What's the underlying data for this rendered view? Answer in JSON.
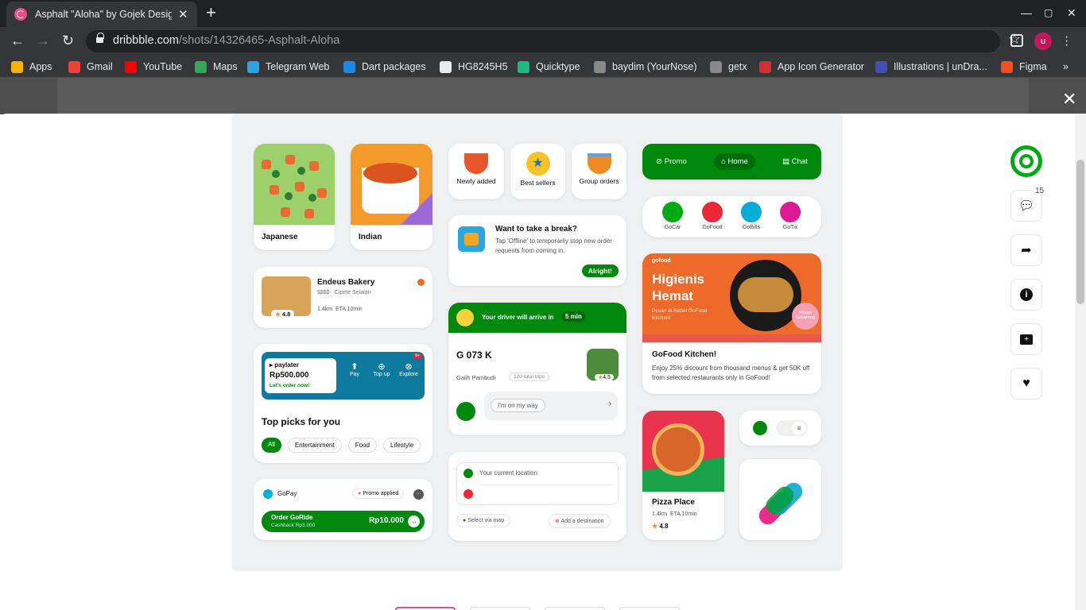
{
  "browser": {
    "tab_title": "Asphalt \"Aloha\" by Gojek Design",
    "url_domain": "dribbble.com",
    "url_path": "/shots/14326465-Asphalt-Aloha",
    "bookmarks": [
      "Apps",
      "Gmail",
      "YouTube",
      "Maps",
      "Telegram Web",
      "Dart packages",
      "HG8245H5",
      "Quicktype",
      "baydim (YourNose)",
      "getx",
      "App Icon Generator",
      "Illustrations | unDra...",
      "Figma"
    ],
    "bookmark_colors": [
      "#f4b400",
      "#ea4335",
      "#ff0000",
      "#34a853",
      "#2aa3e0",
      "#1e88e5",
      "#e8eaed",
      "#1eb980",
      "#888888",
      "#888888",
      "#d32f2f",
      "#3f51b5",
      "#f24e1e"
    ],
    "avatar_letter": "u"
  },
  "shot": {
    "japanese": "Japanese",
    "indian": "Indian",
    "newly_added": "Newly added",
    "best_sellers": "Best sellers",
    "group_orders": "Group orders",
    "break_title": "Want to take a break?",
    "break_body": "Tap 'Offline' to temporarily stop new order requests from coming in.",
    "alright": "Alright!",
    "nav_promo": "Promo",
    "nav_home": "Home",
    "nav_chat": "Chat",
    "svc_gocar": "GoCar",
    "svc_gofood": "GoFood",
    "svc_gobills": "GoBills",
    "svc_gotix": "GoTix",
    "bakery_name": "Endeus Bakery",
    "bakery_meta": "$$$$ · Cipete Selatan",
    "bakery_rating": "4.8",
    "bakery_dist": "1.4km",
    "bakery_eta": "ETA 10min",
    "driver_banner": "Your driver will arrive in",
    "driver_eta": "5 min",
    "plate": "G 073 K",
    "driver_name": "Galih Pambudi",
    "driver_trips": "120 total trips",
    "driver_rating": "4.5",
    "on_my_way": "I'm on my way",
    "gofood_brand": "gofood",
    "hero_line1": "Higienis",
    "hero_line2": "Hemat",
    "hero_sub": "Pesan di Rebel GoFood Kitchen!",
    "hero_badge": "Pesan Sekarang",
    "kitchen_title": "GoFood Kitchen!",
    "kitchen_body": "Enjoy 25% discount from thousand menus & get 50K off from selected restaurants only in GoFood!",
    "paylater": "paylater",
    "paylater_amount": "Rp500.000",
    "paylater_cta": "Let's order now!",
    "pay": "Pay",
    "topup": "Top up",
    "explore": "Explore",
    "explore_badge": "9+",
    "top_picks": "Top picks for you",
    "chips": [
      "All",
      "Entertainment",
      "Food",
      "Lifestyle"
    ],
    "current_location": "Your current location",
    "select_map": "Select via map",
    "add_destination": "Add a destination",
    "pizza_name": "Pizza Place",
    "pizza_dist": "1.4km",
    "pizza_eta": "ETA 10min",
    "pizza_rating": "4.8",
    "gopay": "GoPay",
    "promo_applied": "Promo applied",
    "order_goride": "Order GoRide",
    "cashback": "Cashback Rp3.000",
    "price": "Rp10.000"
  },
  "sidebar": {
    "comments_count": "15"
  }
}
